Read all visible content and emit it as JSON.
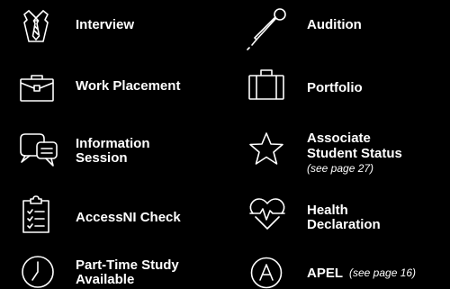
{
  "colors": {
    "background": "#000000",
    "foreground": "#ffffff"
  },
  "items": [
    {
      "label": "Interview",
      "icon": "shirt-tie-icon"
    },
    {
      "label": "Audition",
      "icon": "microphone-icon"
    },
    {
      "label": "Work Placement",
      "icon": "briefcase-icon"
    },
    {
      "label": "Portfolio",
      "icon": "suitcase-icon"
    },
    {
      "label_line1": "Information",
      "label_line2": "Session",
      "icon": "speech-bubbles-icon"
    },
    {
      "label_line1": "Associate",
      "label_line2": "Student Status",
      "note": "(see page 27)",
      "icon": "star-icon"
    },
    {
      "label": "AccessNI Check",
      "icon": "clipboard-checklist-icon"
    },
    {
      "label_line1": "Health",
      "label_line2": "Declaration",
      "icon": "heart-pulse-icon"
    },
    {
      "label_line1": "Part-Time Study",
      "label_line2": "Available",
      "icon": "clock-icon"
    },
    {
      "label": "APEL",
      "note": "(see page 16)",
      "icon": "letter-a-circle-icon"
    }
  ]
}
